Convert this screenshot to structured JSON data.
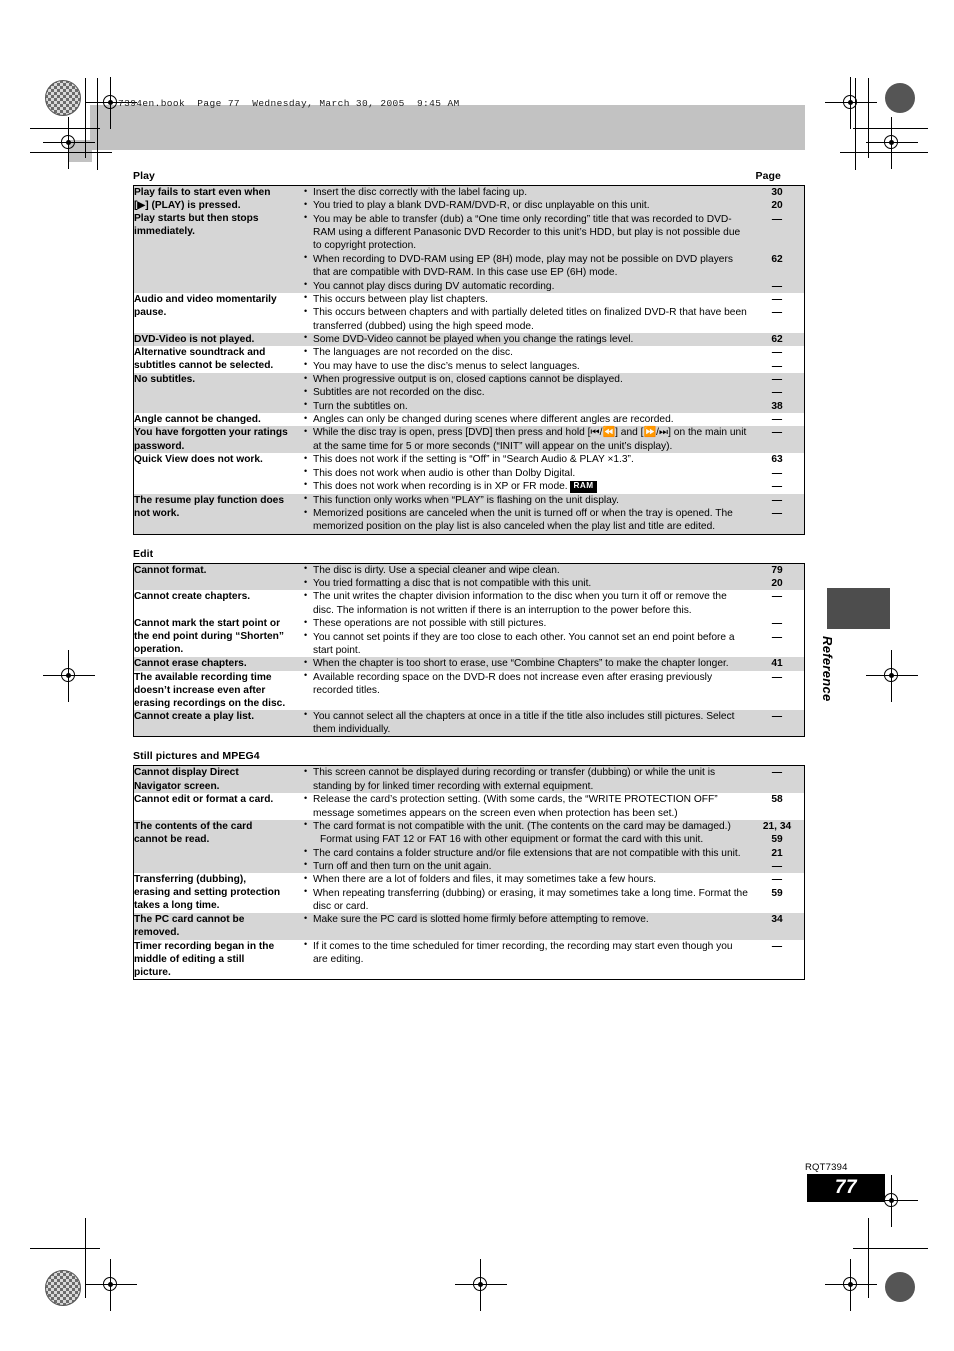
{
  "print_header": {
    "file_line": "7394en.book  Page 77  Wednesday, March 30, 2005  9:45 AM"
  },
  "side_tab": {
    "label": "Reference"
  },
  "footer": {
    "model_code": "RQT7394",
    "page_number": "77"
  },
  "page_column_header": "Page",
  "sections": [
    {
      "title": "Play",
      "show_page_header": true,
      "rows": [
        {
          "shaded": true,
          "symptom": [
            "Play fails to start even when",
            "[▶] (PLAY) is pressed.",
            "Play starts but then stops",
            "immediately."
          ],
          "checks": [
            {
              "text": "Insert the disc correctly with the label facing up.",
              "page": "30"
            },
            {
              "text": "You tried to play a blank DVD-RAM/DVD-R, or disc unplayable on this unit.",
              "page": "20"
            },
            {
              "text": "You may be able to transfer (dub) a “One time only recording” title that was recorded to DVD-RAM using a different Panasonic DVD Recorder to this unit’s HDD, but play is not possible due to copyright protection.",
              "page": "—"
            },
            {
              "text": "When recording to DVD-RAM using EP (8H) mode, play may not be possible on DVD players that are compatible with DVD-RAM. In this case use EP (6H) mode.",
              "page": "62"
            },
            {
              "text": "You cannot play discs during DV automatic recording.",
              "page": "—"
            }
          ]
        },
        {
          "shaded": false,
          "symptom": [
            "Audio and video momentarily",
            "pause."
          ],
          "checks": [
            {
              "text": "This occurs between play list chapters.",
              "page": "—"
            },
            {
              "text": "This occurs between chapters and with partially deleted titles on finalized DVD-R that have been transferred (dubbed) using the high speed mode.",
              "page": "—"
            }
          ]
        },
        {
          "shaded": true,
          "symptom": [
            "DVD-Video is not played."
          ],
          "checks": [
            {
              "text": "Some DVD-Video cannot be played when you change the ratings level.",
              "page": "62"
            }
          ]
        },
        {
          "shaded": false,
          "symptom": [
            "Alternative soundtrack and",
            "subtitles cannot be selected."
          ],
          "checks": [
            {
              "text": "The languages are not recorded on the disc.",
              "page": "—"
            },
            {
              "text": "You may have to use the disc’s menus to select languages.",
              "page": "—"
            }
          ]
        },
        {
          "shaded": true,
          "symptom": [
            "No subtitles."
          ],
          "checks": [
            {
              "text": "When progressive output is on, closed captions cannot be displayed.",
              "page": "—"
            },
            {
              "text": "Subtitles are not recorded on the disc.",
              "page": "—"
            },
            {
              "text": "Turn the subtitles on.",
              "page": "38"
            }
          ]
        },
        {
          "shaded": false,
          "symptom": [
            "Angle cannot be changed."
          ],
          "checks": [
            {
              "text": "Angles can only be changed during scenes where different angles are recorded.",
              "page": "—"
            }
          ]
        },
        {
          "shaded": true,
          "symptom": [
            "You have forgotten your ratings",
            "password."
          ],
          "checks": [
            {
              "text": "While the disc tray is open, press [DVD] then press and hold [⏮/⏪] and [⏩/⏭] on the main unit at the same time for 5 or more seconds (“INIT” will appear on the unit’s display).",
              "page": "—"
            }
          ]
        },
        {
          "shaded": false,
          "symptom": [
            "Quick View does not work."
          ],
          "checks": [
            {
              "text": "This does not work if the setting is “Off” in “Search Audio & PLAY ×1.3”.",
              "page": "63"
            },
            {
              "text": "This does not work when audio is other than Dolby Digital.",
              "page": "—"
            },
            {
              "text": "This does not work when recording is in XP or FR mode.",
              "badge": "RAM",
              "page": "—"
            }
          ]
        },
        {
          "shaded": true,
          "symptom": [
            "The resume play function does",
            "not work."
          ],
          "checks": [
            {
              "text": "This function only works when “PLAY” is flashing on the unit display.",
              "page": "—"
            },
            {
              "text": "Memorized positions are canceled when the unit is turned off or when the tray is opened. The memorized position on the play list is also canceled when the play list and title are edited.",
              "page": "—"
            }
          ]
        }
      ]
    },
    {
      "title": "Edit",
      "show_page_header": false,
      "rows": [
        {
          "shaded": true,
          "symptom": [
            "Cannot format."
          ],
          "checks": [
            {
              "text": "The disc is dirty. Use a special cleaner and wipe clean.",
              "page": "79"
            },
            {
              "text": "You tried formatting a disc that is not compatible with this unit.",
              "page": "20"
            }
          ]
        },
        {
          "shaded": false,
          "symptom": [
            "Cannot create chapters.",
            "",
            "Cannot mark the start point or",
            "the end point during “Shorten”",
            "operation."
          ],
          "checks": [
            {
              "text": "The unit writes the chapter division information to the disc when you turn it off or remove the disc. The information is not written if there is an interruption to the power before this.",
              "page": "—"
            },
            {
              "text": "These operations are not possible with still pictures.",
              "page": "—"
            },
            {
              "text": "You cannot set points if they are too close to each other. You cannot set an end point before a start point.",
              "page": "—"
            }
          ]
        },
        {
          "shaded": true,
          "symptom": [
            "Cannot erase chapters."
          ],
          "checks": [
            {
              "text": "When the chapter is too short to erase, use “Combine Chapters” to make the chapter longer.",
              "page": "41"
            }
          ]
        },
        {
          "shaded": false,
          "symptom": [
            "The available recording time",
            "doesn’t increase even after",
            "erasing recordings on the disc."
          ],
          "checks": [
            {
              "text": "Available recording space on the DVD-R does not increase even after erasing previously recorded titles.",
              "page": "—"
            }
          ]
        },
        {
          "shaded": true,
          "symptom": [
            "Cannot create a play list."
          ],
          "checks": [
            {
              "text": "You cannot select all the chapters at once in a title if the title also includes still pictures. Select them individually.",
              "page": "—"
            }
          ]
        }
      ]
    },
    {
      "title": "Still pictures and MPEG4",
      "show_page_header": false,
      "rows": [
        {
          "shaded": true,
          "symptom": [
            "Cannot display Direct",
            "Navigator screen."
          ],
          "checks": [
            {
              "text": "This screen cannot be displayed during recording or transfer (dubbing) or while the unit is standing by for linked timer recording with external equipment.",
              "page": "—"
            }
          ]
        },
        {
          "shaded": false,
          "symptom": [
            "Cannot edit or format a card."
          ],
          "checks": [
            {
              "text": "Release the card’s protection setting. (With some cards, the “WRITE PROTECTION OFF” message sometimes appears on the screen even when protection has been set.)",
              "page": "58"
            }
          ]
        },
        {
          "shaded": true,
          "symptom": [
            "The contents of the card",
            "cannot be read."
          ],
          "checks": [
            {
              "text": "The card format is not compatible with the unit. (The contents on the card may be damaged.)",
              "page": "21, 34"
            },
            {
              "text": "Format using FAT 12 or FAT 16 with other equipment or format the card with this unit.",
              "continuation": true,
              "page": "59"
            },
            {
              "text": "The card contains a folder structure and/or file extensions that are not compatible with this unit.",
              "page": "21"
            },
            {
              "text": "Turn off and then turn on the unit again.",
              "page": "—"
            }
          ]
        },
        {
          "shaded": false,
          "symptom": [
            "Transferring (dubbing),",
            "erasing and setting protection",
            "takes a long time."
          ],
          "checks": [
            {
              "text": "When there are a lot of folders and files, it may sometimes take a few hours.",
              "page": "—"
            },
            {
              "text": "When repeating transferring (dubbing) or erasing, it may sometimes take a long time. Format the disc or card.",
              "page": "59"
            }
          ]
        },
        {
          "shaded": true,
          "symptom": [
            "The PC card cannot be",
            "removed."
          ],
          "checks": [
            {
              "text": "Make sure the PC card is slotted home firmly before attempting to remove.",
              "page": "34"
            }
          ]
        },
        {
          "shaded": false,
          "symptom": [
            "Timer recording began in the",
            "middle of editing a still",
            "picture."
          ],
          "checks": [
            {
              "text": "If it comes to the time scheduled for timer recording, the recording may start even though you are editing.",
              "page": "—"
            }
          ]
        }
      ]
    }
  ]
}
